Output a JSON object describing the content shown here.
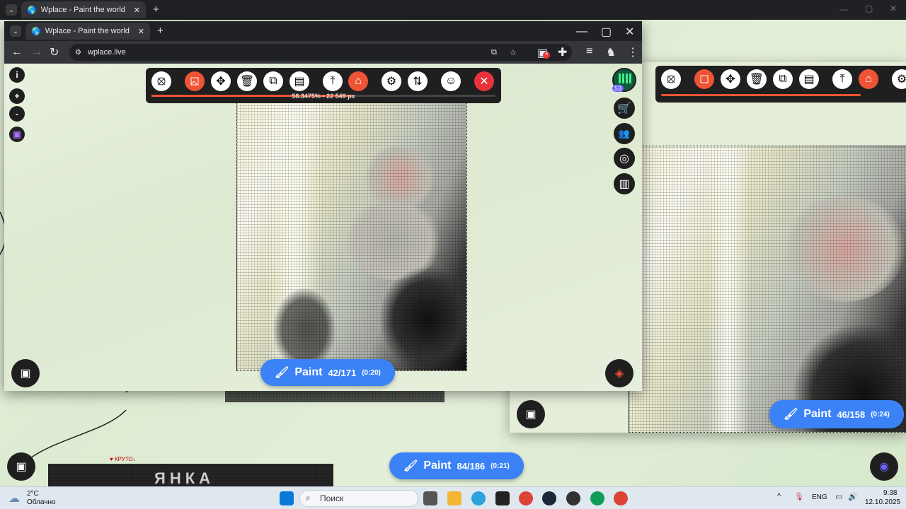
{
  "back_window": {
    "tab_title": "Wplace - Paint the world",
    "add_tab": "+",
    "toolbar_buttons": [
      "orbit",
      "image",
      "move",
      "trash",
      "crop",
      "doc",
      "upload",
      "bot",
      "gear"
    ],
    "paint": {
      "label": "Paint",
      "count": "46/158",
      "timer": "(0:24)"
    }
  },
  "front_window": {
    "tab_title": "Wplace - Paint the world",
    "add_tab": "+",
    "url": "wplace.live",
    "extension_badge": "3",
    "left_controls": {
      "info": "i",
      "zoom_in": "+",
      "zoom_out": "-"
    },
    "toolbar": {
      "progress_percent": "58.3475%",
      "separator": "•",
      "pixels": "22 549 px",
      "progress_fraction": 0.583475
    },
    "avatar_level": "53",
    "paint": {
      "label": "Paint",
      "count": "42/171",
      "timer": "(0:20)"
    }
  },
  "bottom_paint": {
    "label": "Paint",
    "count": "84/186",
    "timer": "(0:21)"
  },
  "sign": {
    "small": "♥ КРУТО↓",
    "big": "ЯНКА"
  },
  "taskbar": {
    "weather_temp": "2°C",
    "weather_text": "Облачно",
    "search_placeholder": "Поиск",
    "lang": "ENG",
    "time": "9:38",
    "date": "12.10.2025"
  },
  "colors": {
    "accent_red": "#ef5336",
    "paint_blue": "#3b82f6",
    "dark": "#1f1f1f"
  }
}
